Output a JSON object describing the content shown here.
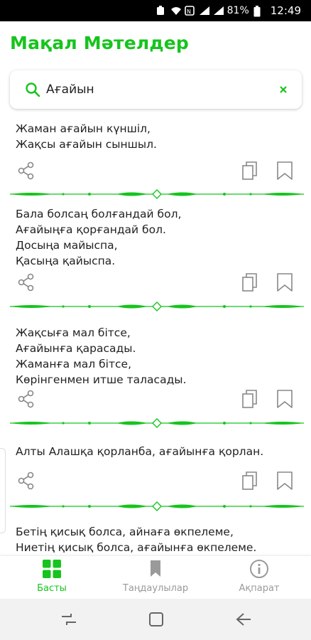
{
  "status_bar": {
    "battery": "81%",
    "time": "12:49"
  },
  "app": {
    "title": "Мақал Мәтелдер",
    "accent_color": "#16c41d"
  },
  "search": {
    "value": "Ағайын",
    "icon": "search-icon",
    "clear_icon": "close-icon"
  },
  "proverbs": [
    {
      "text": "Жаман ағайын күншіл,\nЖақсы ағайын сыншыл."
    },
    {
      "text": "Бала болсаң болғандай бол,\nАғайыңға қорғандай бол.\nДосыңа майыспа,\nҚасыңа қайыспа."
    },
    {
      "text": "Жақсыға мал бітсе,\nАғайынға қарасады.\nЖаманға мал бітсе,\nКөрінгенмен итше таласады."
    },
    {
      "text": "Алты Алашқа қорланба, ағайынға қорлан."
    },
    {
      "text": "Бетің қисық болса, айнаға өкпелеме,\nНиетің қисық болса, ағайынға өкпелеме."
    }
  ],
  "item_actions": {
    "share_icon": "share-icon",
    "copy_icon": "copy-icon",
    "bookmark_icon": "bookmark-icon"
  },
  "bottom_nav": [
    {
      "label": "Басты",
      "icon": "grid-icon",
      "active": true
    },
    {
      "label": "Таңдаулылар",
      "icon": "bookmark-icon",
      "active": false
    },
    {
      "label": "Ақпарат",
      "icon": "info-icon",
      "active": false
    }
  ],
  "system_nav": {
    "recent_icon": "recent-apps-icon",
    "home_icon": "home-icon",
    "back_icon": "back-icon"
  }
}
